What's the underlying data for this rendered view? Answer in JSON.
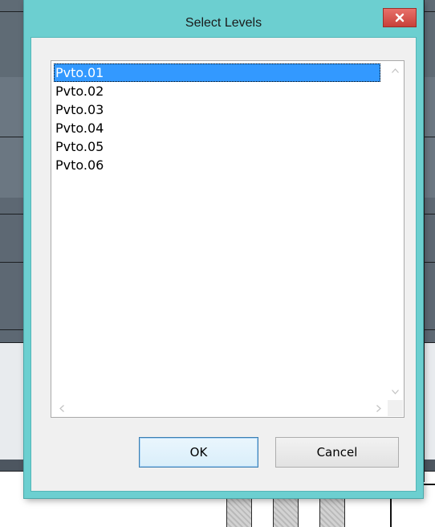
{
  "dialog": {
    "title": "Select Levels",
    "close_icon": "close-x-icon"
  },
  "levels": {
    "items": [
      {
        "label": "Pvto.01",
        "selected": true
      },
      {
        "label": "Pvto.02",
        "selected": false
      },
      {
        "label": "Pvto.03",
        "selected": false
      },
      {
        "label": "Pvto.04",
        "selected": false
      },
      {
        "label": "Pvto.05",
        "selected": false
      },
      {
        "label": "Pvto.06",
        "selected": false
      }
    ]
  },
  "buttons": {
    "ok_label": "OK",
    "cancel_label": "Cancel"
  },
  "colors": {
    "window_frame": "#6ccfd0",
    "selection": "#3399ff",
    "close_button": "#c8413a"
  }
}
